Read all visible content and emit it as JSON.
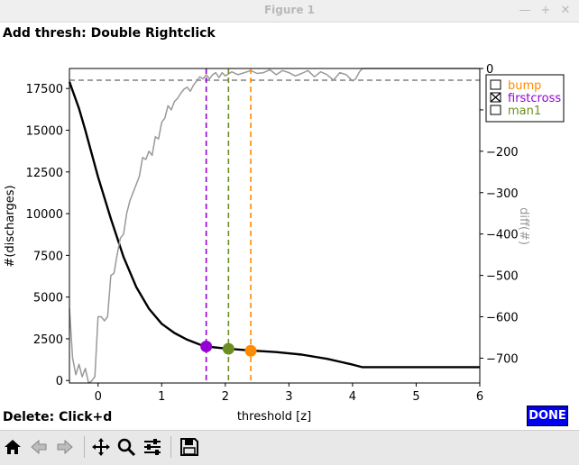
{
  "window": {
    "title": "Figure 1",
    "min_glyph": "—",
    "max_glyph": "+",
    "close_glyph": "✕"
  },
  "instructions": {
    "top": "Add thresh: Double Rightclick",
    "bottom": "Delete: Click+d"
  },
  "done_button": {
    "label": "DONE"
  },
  "toolbar": {
    "buttons": [
      {
        "name": "home-icon",
        "label": "Home"
      },
      {
        "name": "back-arrow-icon",
        "label": "Back"
      },
      {
        "name": "forward-arrow-icon",
        "label": "Forward"
      },
      {
        "name": "pan-icon",
        "label": "Pan"
      },
      {
        "name": "zoom-icon",
        "label": "Zoom"
      },
      {
        "name": "configure-subplots-icon",
        "label": "Subplots"
      },
      {
        "name": "save-icon",
        "label": "Save"
      }
    ]
  },
  "colors": {
    "black_curve": "#000000",
    "diff_curve": "#999999",
    "bump": "#ff8c00",
    "firstcross": "#9400d3",
    "man1": "#6b8e23",
    "reference": "#808080",
    "done_bg": "#0000ee"
  },
  "chart_data": {
    "type": "line",
    "xlabel": "threshold [z]",
    "ylabel_left": "#(discharges)",
    "ylabel_right": "diff(#)",
    "xlim": [
      -0.45,
      6
    ],
    "ylim_left": [
      -150,
      18700
    ],
    "ylim_right": [
      -760,
      0
    ],
    "xticks": [
      0,
      1,
      2,
      3,
      4,
      5,
      6
    ],
    "yticks_left": [
      0,
      2500,
      5000,
      7500,
      10000,
      12500,
      15000,
      17500
    ],
    "yticks_right": [
      0,
      -100,
      -200,
      -300,
      -400,
      -500,
      -600,
      -700
    ],
    "grid": false,
    "legend_placement": "top-right, outside axes",
    "series": [
      {
        "name": "#(discharges)",
        "axis": "left",
        "color": "#000000",
        "x": [
          -0.45,
          -0.3,
          -0.2,
          0,
          0.2,
          0.4,
          0.6,
          0.8,
          1.0,
          1.2,
          1.4,
          1.6,
          1.7,
          2.0,
          2.4,
          2.8,
          3.2,
          3.6,
          4.0,
          4.15,
          4.5,
          5.0,
          5.5,
          6.0
        ],
        "y": [
          17900,
          16300,
          15000,
          12200,
          9700,
          7400,
          5600,
          4300,
          3400,
          2850,
          2450,
          2150,
          2040,
          1920,
          1800,
          1700,
          1550,
          1300,
          950,
          800,
          800,
          800,
          800,
          800
        ]
      },
      {
        "name": "diff(#)",
        "axis": "right",
        "color": "#999999",
        "x": [
          -0.45,
          -0.4,
          -0.35,
          -0.3,
          -0.25,
          -0.2,
          -0.15,
          -0.1,
          -0.05,
          0.0,
          0.05,
          0.1,
          0.15,
          0.2,
          0.25,
          0.3,
          0.35,
          0.4,
          0.45,
          0.5,
          0.55,
          0.6,
          0.65,
          0.7,
          0.75,
          0.8,
          0.85,
          0.9,
          0.95,
          1.0,
          1.05,
          1.1,
          1.15,
          1.2,
          1.25,
          1.3,
          1.35,
          1.4,
          1.45,
          1.5,
          1.55,
          1.6,
          1.65,
          1.7,
          1.75,
          1.8,
          1.85,
          1.9,
          1.95,
          2.0,
          2.1,
          2.2,
          2.3,
          2.4,
          2.5,
          2.6,
          2.7,
          2.8,
          2.9,
          3.0,
          3.1,
          3.2,
          3.3,
          3.4,
          3.5,
          3.6,
          3.7,
          3.8,
          3.9,
          4.0,
          4.05,
          4.1,
          4.15,
          4.2,
          4.5,
          5.0,
          5.5,
          6.0
        ],
        "y": [
          -580,
          -700,
          -740,
          -715,
          -745,
          -725,
          -760,
          -755,
          -745,
          -600,
          -600,
          -610,
          -600,
          -500,
          -495,
          -450,
          -410,
          -400,
          -350,
          -320,
          -300,
          -280,
          -260,
          -215,
          -220,
          -200,
          -210,
          -165,
          -170,
          -130,
          -120,
          -90,
          -100,
          -80,
          -72,
          -60,
          -50,
          -45,
          -55,
          -40,
          -30,
          -20,
          -25,
          -15,
          -25,
          -15,
          -10,
          -22,
          -10,
          -18,
          -8,
          -15,
          -10,
          -5,
          -12,
          -10,
          -3,
          -15,
          -5,
          -10,
          -18,
          -12,
          -5,
          -20,
          -8,
          -15,
          -28,
          -10,
          -15,
          -30,
          -25,
          -10,
          0,
          0,
          0,
          0,
          0,
          0
        ]
      }
    ],
    "reference_line": {
      "axis": "left",
      "y": 18000,
      "style": "dashed",
      "color": "#808080"
    },
    "thresholds": [
      {
        "name": "firstcross",
        "x": 1.7,
        "y": 2040,
        "color": "#9400d3",
        "checked": true
      },
      {
        "name": "man1",
        "x": 2.05,
        "y": 1900,
        "color": "#6b8e23",
        "checked": false
      },
      {
        "name": "bump",
        "x": 2.4,
        "y": 1780,
        "color": "#ff8c00",
        "checked": false
      }
    ],
    "legend": [
      {
        "name": "bump",
        "color": "#ff8c00",
        "checked": false
      },
      {
        "name": "firstcross",
        "color": "#9400d3",
        "checked": true
      },
      {
        "name": "man1",
        "color": "#6b8e23",
        "checked": false
      }
    ]
  }
}
